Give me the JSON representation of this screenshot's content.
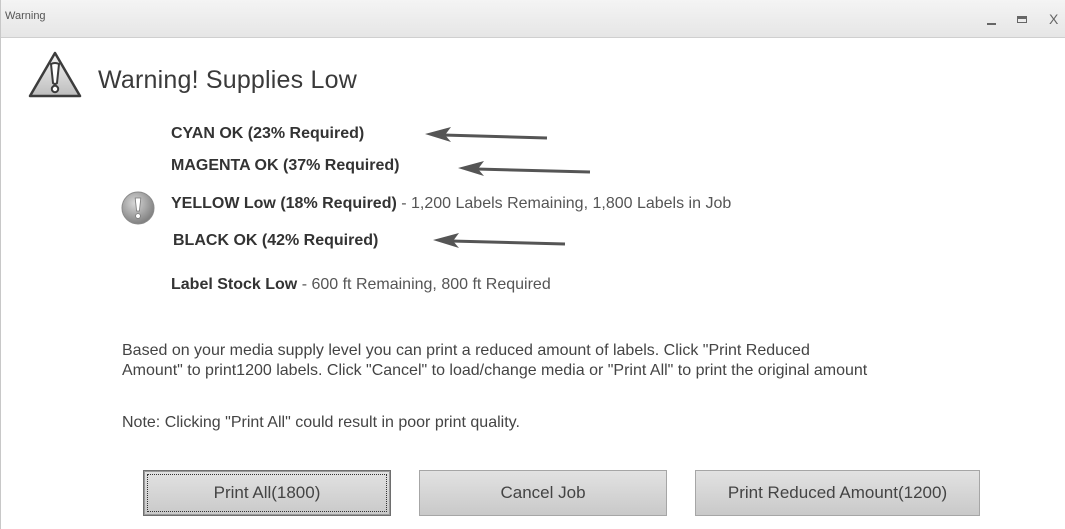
{
  "window": {
    "title": "Warning",
    "controls": {
      "minimize": "_",
      "maximize": "□",
      "close": "X"
    }
  },
  "heading": "Warning!  Supplies Low",
  "supplies": [
    {
      "label": "CYAN OK (23% Required)",
      "detail": "",
      "status": "ok"
    },
    {
      "label": "MAGENTA OK (37% Required)",
      "detail": "",
      "status": "ok"
    },
    {
      "label": "YELLOW Low (18% Required)",
      "detail": " - 1,200 Labels Remaining, 1,800 Labels in Job",
      "status": "low"
    },
    {
      "label": "BLACK OK (42% Required)",
      "detail": "",
      "status": "ok"
    },
    {
      "label": "Label Stock Low",
      "detail": "  - 600 ft Remaining, 800 ft Required",
      "status": "low"
    }
  ],
  "message": {
    "line1": "Based on your media supply level you can print a reduced amount of labels. Click \"Print Reduced",
    "line2": "Amount\" to print1200 labels. Click \"Cancel\" to load/change media or \"Print All\" to print the original amount",
    "note": "Note: Clicking \"Print All\" could result in poor print quality."
  },
  "buttons": {
    "print_all": "Print All(1800)",
    "cancel": "Cancel Job",
    "print_reduced": "Print Reduced Amount(1200)"
  },
  "icons": {
    "warning": "warning-triangle-icon",
    "alert": "exclamation-circle-icon",
    "arrow": "left-arrow-icon"
  },
  "colors": {
    "arrow": "#555555",
    "button_bg": "#d6d6d6",
    "text": "#333333"
  }
}
